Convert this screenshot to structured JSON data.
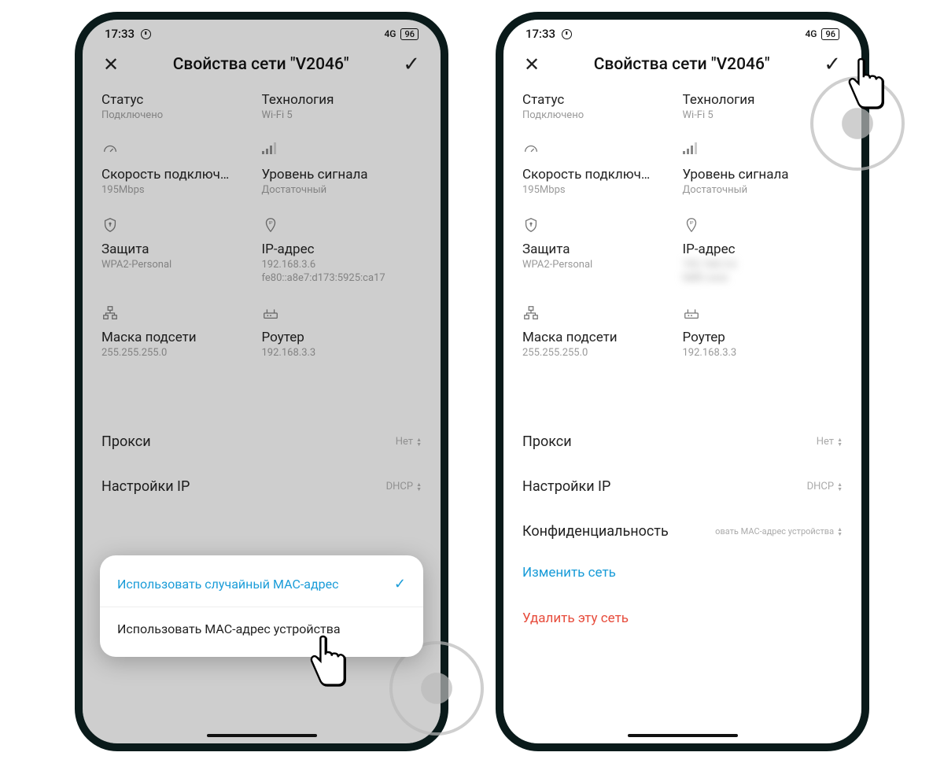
{
  "status": {
    "time": "17:33",
    "net": "4G",
    "battery": "96"
  },
  "header": {
    "title": "Свойства сети \"V2046\""
  },
  "cells": {
    "status": {
      "label": "Статус",
      "value": "Подключено"
    },
    "tech": {
      "label": "Технология",
      "value": "Wi-Fi 5"
    },
    "speed": {
      "label": "Скорость подключ…",
      "value": "195Mbps"
    },
    "signal": {
      "label": "Уровень сигнала",
      "value": "Достаточный"
    },
    "security": {
      "label": "Защита",
      "value": "WPA2-Personal"
    },
    "ip": {
      "label": "IP-адрес",
      "value1": "192.168.3.6",
      "value2": "fe80::a8e7:d173:5925:ca17"
    },
    "subnet": {
      "label": "Маска подсети",
      "value": "255.255.255.0"
    },
    "router": {
      "label": "Роутер",
      "value": "192.168.3.3"
    }
  },
  "rows": {
    "proxy": {
      "label": "Прокси",
      "value": "Нет"
    },
    "ipset": {
      "label": "Настройки IP",
      "value": "DHCP"
    },
    "privacy": {
      "label": "Конфиденциальность",
      "value": "овать MAC-адрес устройства"
    }
  },
  "links": {
    "edit": "Изменить сеть",
    "delete": "Удалить эту сеть"
  },
  "popup": {
    "opt_selected": "Использовать случайный MAC-адрес",
    "opt_other": "Использовать MAC-адрес устройства"
  }
}
